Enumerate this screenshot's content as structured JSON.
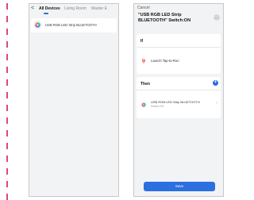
{
  "left_screen": {
    "back_glyph": "<",
    "tabs": [
      {
        "label": "All Devices",
        "active": true
      },
      {
        "label": "Living Room",
        "active": false
      },
      {
        "label": "Master E",
        "active": false
      }
    ],
    "device": {
      "name": "USB RGB LED Strip BLUETOOTH",
      "icon": "bulb-icon"
    }
  },
  "right_screen": {
    "cancel_label": "Cancel",
    "title": "\"USB RGB LED Strip BLUETOOTH\" Switch:ON",
    "more_glyph": "…",
    "if_section": {
      "label": "If",
      "condition": {
        "icon": "tap-to-run-icon",
        "text": "Launch Tap-to-Run"
      }
    },
    "then_section": {
      "label": "Then",
      "action": {
        "icon": "bulb-icon",
        "name": "USB RGB LED Strip BLUETOOTH",
        "detail": "Switch:ON"
      }
    },
    "save_label": "Save"
  },
  "colors": {
    "accent": "#2b6fe0",
    "background": "#f2f3f5",
    "card": "#ffffff",
    "dash": "#e0457b"
  }
}
